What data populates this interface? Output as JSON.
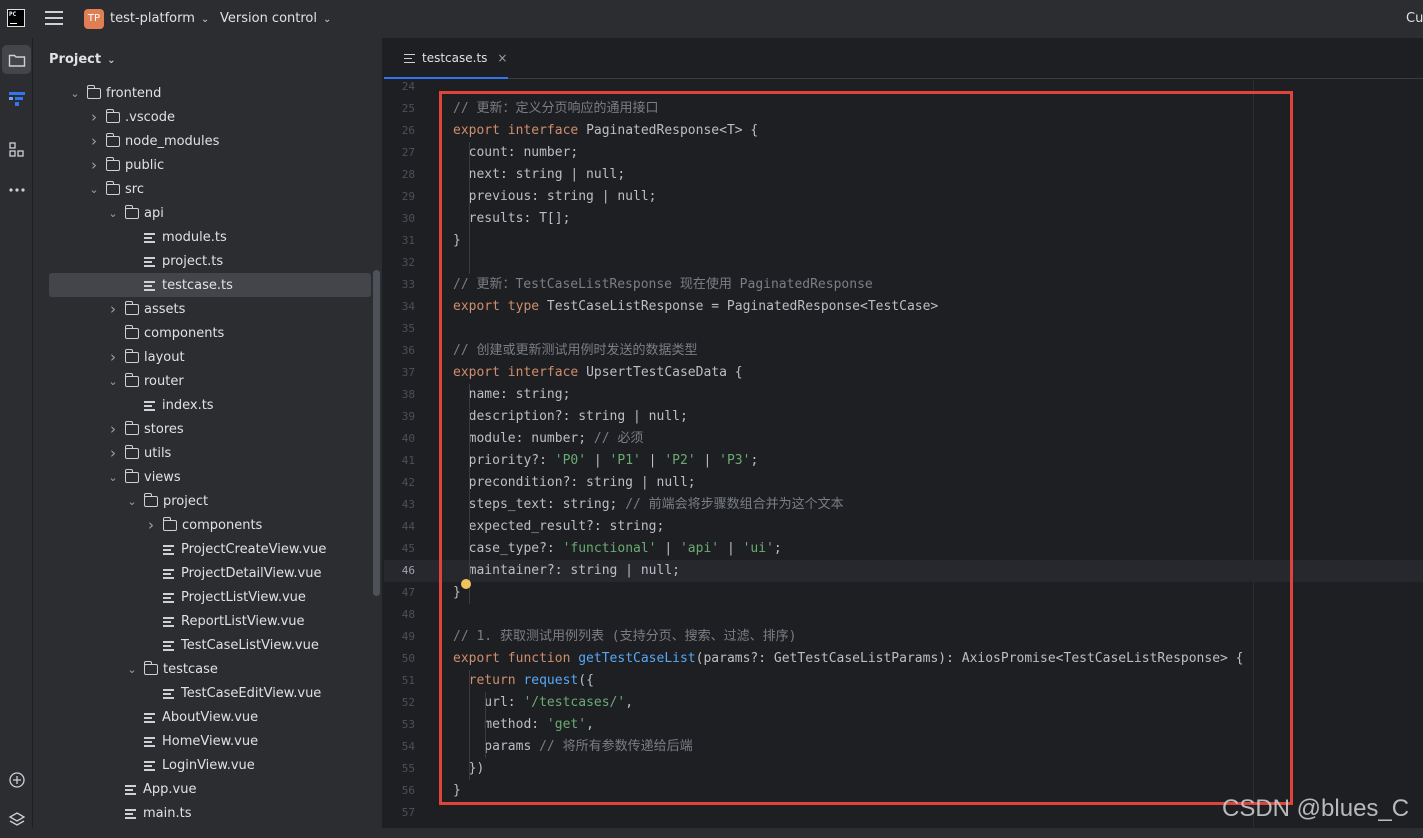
{
  "titlebar": {
    "logo_text": "PC",
    "project_badge": "TP",
    "project_name": "test-platform",
    "vcs_label": "Version control",
    "right_truncated": "Cu"
  },
  "project_panel": {
    "title": "Project",
    "tree": [
      {
        "label": "frontend",
        "type": "folder",
        "depth": 0,
        "expanded": true
      },
      {
        "label": ".vscode",
        "type": "folder",
        "depth": 1,
        "expanded": false
      },
      {
        "label": "node_modules",
        "type": "folder",
        "depth": 1,
        "expanded": false
      },
      {
        "label": "public",
        "type": "folder",
        "depth": 1,
        "expanded": false
      },
      {
        "label": "src",
        "type": "folder",
        "depth": 1,
        "expanded": true
      },
      {
        "label": "api",
        "type": "folder",
        "depth": 2,
        "expanded": true
      },
      {
        "label": "module.ts",
        "type": "file",
        "depth": 3
      },
      {
        "label": "project.ts",
        "type": "file",
        "depth": 3
      },
      {
        "label": "testcase.ts",
        "type": "file",
        "depth": 3,
        "selected": true
      },
      {
        "label": "assets",
        "type": "folder",
        "depth": 2,
        "expanded": false
      },
      {
        "label": "components",
        "type": "folder",
        "depth": 2,
        "leaf": true
      },
      {
        "label": "layout",
        "type": "folder",
        "depth": 2,
        "expanded": false
      },
      {
        "label": "router",
        "type": "folder",
        "depth": 2,
        "expanded": true
      },
      {
        "label": "index.ts",
        "type": "file",
        "depth": 3
      },
      {
        "label": "stores",
        "type": "folder",
        "depth": 2,
        "expanded": false
      },
      {
        "label": "utils",
        "type": "folder",
        "depth": 2,
        "expanded": false
      },
      {
        "label": "views",
        "type": "folder",
        "depth": 2,
        "expanded": true
      },
      {
        "label": "project",
        "type": "folder",
        "depth": 3,
        "expanded": true
      },
      {
        "label": "components",
        "type": "folder",
        "depth": 4,
        "expanded": false
      },
      {
        "label": "ProjectCreateView.vue",
        "type": "file",
        "depth": 4
      },
      {
        "label": "ProjectDetailView.vue",
        "type": "file",
        "depth": 4
      },
      {
        "label": "ProjectListView.vue",
        "type": "file",
        "depth": 4
      },
      {
        "label": "ReportListView.vue",
        "type": "file",
        "depth": 4
      },
      {
        "label": "TestCaseListView.vue",
        "type": "file",
        "depth": 4
      },
      {
        "label": "testcase",
        "type": "folder",
        "depth": 3,
        "expanded": true
      },
      {
        "label": "TestCaseEditView.vue",
        "type": "file",
        "depth": 4
      },
      {
        "label": "AboutView.vue",
        "type": "file",
        "depth": 3
      },
      {
        "label": "HomeView.vue",
        "type": "file",
        "depth": 3
      },
      {
        "label": "LoginView.vue",
        "type": "file",
        "depth": 3
      },
      {
        "label": "App.vue",
        "type": "file",
        "depth": 2
      },
      {
        "label": "main.ts",
        "type": "file",
        "depth": 2
      }
    ]
  },
  "editor": {
    "tab_label": "testcase.ts",
    "tab_close": "×",
    "current_line": 46,
    "lines": [
      {
        "n": "24",
        "t": []
      },
      {
        "n": "25",
        "t": [
          [
            "cm",
            "// 更新：定义分页响应的通用接口"
          ]
        ]
      },
      {
        "n": "26",
        "t": [
          [
            "kw",
            "export interface "
          ],
          [
            "p",
            "PaginatedResponse<T> {"
          ]
        ]
      },
      {
        "n": "27",
        "t": [
          [
            "p",
            "  count: number;"
          ]
        ]
      },
      {
        "n": "28",
        "t": [
          [
            "p",
            "  next: string | null;"
          ]
        ]
      },
      {
        "n": "29",
        "t": [
          [
            "p",
            "  previous: string | null;"
          ]
        ]
      },
      {
        "n": "30",
        "t": [
          [
            "p",
            "  results: T[];"
          ]
        ]
      },
      {
        "n": "31",
        "t": [
          [
            "p",
            "}"
          ]
        ]
      },
      {
        "n": "32",
        "t": []
      },
      {
        "n": "33",
        "t": [
          [
            "cm",
            "// 更新：TestCaseListResponse 现在使用 PaginatedResponse"
          ]
        ]
      },
      {
        "n": "34",
        "t": [
          [
            "kw",
            "export type "
          ],
          [
            "p",
            "TestCaseListResponse = PaginatedResponse<TestCase>"
          ]
        ]
      },
      {
        "n": "35",
        "t": []
      },
      {
        "n": "36",
        "t": [
          [
            "cm",
            "// 创建或更新测试用例时发送的数据类型"
          ]
        ]
      },
      {
        "n": "37",
        "t": [
          [
            "kw",
            "export interface "
          ],
          [
            "p",
            "UpsertTestCaseData {"
          ]
        ]
      },
      {
        "n": "38",
        "t": [
          [
            "p",
            "  name: string;"
          ]
        ]
      },
      {
        "n": "39",
        "t": [
          [
            "p",
            "  description?: string | null;"
          ]
        ]
      },
      {
        "n": "40",
        "t": [
          [
            "p",
            "  module: number; "
          ],
          [
            "cm",
            "// 必须"
          ]
        ]
      },
      {
        "n": "41",
        "t": [
          [
            "p",
            "  priority?: "
          ],
          [
            "str",
            "'P0'"
          ],
          [
            "p",
            " | "
          ],
          [
            "str",
            "'P1'"
          ],
          [
            "p",
            " | "
          ],
          [
            "str",
            "'P2'"
          ],
          [
            "p",
            " | "
          ],
          [
            "str",
            "'P3'"
          ],
          [
            "p",
            ";"
          ]
        ]
      },
      {
        "n": "42",
        "t": [
          [
            "p",
            "  precondition?: string | null;"
          ]
        ]
      },
      {
        "n": "43",
        "t": [
          [
            "p",
            "  steps_text: string; "
          ],
          [
            "cm",
            "// 前端会将步骤数组合并为这个文本"
          ]
        ]
      },
      {
        "n": "44",
        "t": [
          [
            "p",
            "  expected_result?: string;"
          ]
        ]
      },
      {
        "n": "45",
        "t": [
          [
            "p",
            "  case_type?: "
          ],
          [
            "str",
            "'functional'"
          ],
          [
            "p",
            " | "
          ],
          [
            "str",
            "'api'"
          ],
          [
            "p",
            " | "
          ],
          [
            "str",
            "'ui'"
          ],
          [
            "p",
            ";"
          ]
        ]
      },
      {
        "n": "46",
        "t": [
          [
            "p",
            "  maintainer?: string | null;"
          ]
        ]
      },
      {
        "n": "47",
        "t": [
          [
            "p",
            "}"
          ]
        ]
      },
      {
        "n": "48",
        "t": []
      },
      {
        "n": "49",
        "t": [
          [
            "cm",
            "// 1. 获取测试用例列表 (支持分页、搜索、过滤、排序)"
          ]
        ]
      },
      {
        "n": "50",
        "t": [
          [
            "kw",
            "export function "
          ],
          [
            "fn",
            "getTestCaseList"
          ],
          [
            "p",
            "(params?: GetTestCaseListParams): AxiosPromise<TestCaseListResponse> {"
          ]
        ]
      },
      {
        "n": "51",
        "t": [
          [
            "kw",
            "  return "
          ],
          [
            "fn",
            "request"
          ],
          [
            "p",
            "({"
          ]
        ]
      },
      {
        "n": "52",
        "t": [
          [
            "p",
            "    url: "
          ],
          [
            "str",
            "'/testcases/'"
          ],
          [
            "p",
            ","
          ]
        ]
      },
      {
        "n": "53",
        "t": [
          [
            "p",
            "    method: "
          ],
          [
            "str",
            "'get'"
          ],
          [
            "p",
            ","
          ]
        ]
      },
      {
        "n": "54",
        "t": [
          [
            "p",
            "    params "
          ],
          [
            "cm",
            "// 将所有参数传递给后端"
          ]
        ]
      },
      {
        "n": "55",
        "t": [
          [
            "p",
            "  })"
          ]
        ]
      },
      {
        "n": "56",
        "t": [
          [
            "p",
            "}"
          ]
        ]
      },
      {
        "n": "57",
        "t": []
      }
    ]
  },
  "watermark": "CSDN @blues_C",
  "colors": {
    "highlight_box": "#e0433a",
    "keyword": "#cf8e6d",
    "string": "#6aab73",
    "function": "#56a8f5",
    "comment": "#7a7e85",
    "accent": "#3574f0"
  }
}
